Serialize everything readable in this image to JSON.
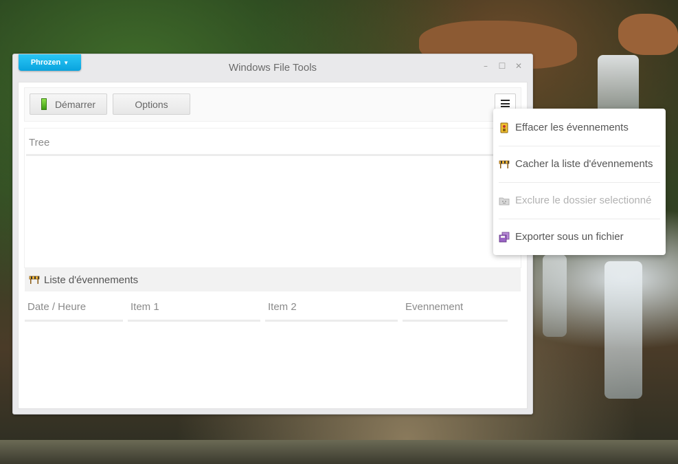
{
  "window": {
    "title": "Windows File Tools",
    "brand_label": "Phrozen",
    "brand_caret": "▼",
    "minimize": "–",
    "maximize": "☐",
    "close": "✕"
  },
  "toolbar": {
    "start_label": "Démarrer",
    "options_label": "Options"
  },
  "tree": {
    "header": "Tree"
  },
  "events": {
    "title": "Liste d'évennements",
    "columns": [
      "Date / Heure",
      "Item 1",
      "Item 2",
      "Evennement"
    ]
  },
  "menu": {
    "items": [
      {
        "label": "Effacer les évennements",
        "icon": "clear-icon",
        "enabled": true
      },
      {
        "label": "Cacher la liste d'évennements",
        "icon": "barrier-icon",
        "enabled": true
      },
      {
        "label": "Exclure le dossier selectionné",
        "icon": "folder-exclude-icon",
        "enabled": false
      },
      {
        "label": "Exporter sous un fichier",
        "icon": "export-file-icon",
        "enabled": true
      }
    ]
  },
  "colors": {
    "accent": "#0aa3de",
    "start_indicator": "#3d9b13"
  }
}
